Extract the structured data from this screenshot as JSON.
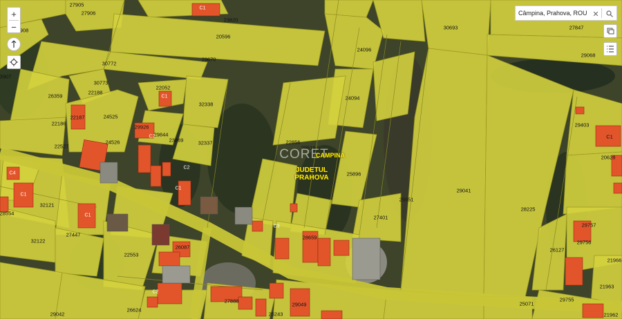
{
  "search": {
    "value": "Câmpina, Prahova, ROU"
  },
  "controls": {
    "zoom_in": "+",
    "zoom_out": "−"
  },
  "region_label": {
    "line1": "JUDETUL",
    "line2": "PRAHOVA"
  },
  "locality_label": "CAMPINA",
  "watermark": "CORET",
  "parcel_ids": [
    "27905",
    "27906",
    "908",
    "23820",
    "20596",
    "30693",
    "27847",
    "29068",
    "29670",
    "24096",
    "30772",
    "3907",
    "30773",
    "22188",
    "22052",
    "26359",
    "32338",
    "24094",
    "22187",
    "22186",
    "24525",
    "29926",
    "29844",
    "23869",
    "32337",
    "29403",
    "22527",
    "24526",
    "22856",
    "29519",
    "C1",
    "20628",
    "25896",
    "29041",
    "28554",
    "32121",
    "25551",
    "28225",
    "27447",
    "27401",
    "32122",
    "28659",
    "26087",
    "22553",
    "26127",
    "21966",
    "27888",
    "29049",
    "21963",
    "29042",
    "26624",
    "25243",
    "25071",
    "29755",
    "29757",
    "29756",
    "21962"
  ],
  "building_labels": [
    "C1",
    "C1",
    "C1",
    "C1",
    "C2",
    "C4",
    "C2",
    "C1",
    "C3",
    "C2"
  ],
  "colors": {
    "parcel_fill": "#d4d23e",
    "building_fill": "#e2552b",
    "road": "#c8c637",
    "vegetation_dark": "#3a4a26",
    "label_yellow": "#ffef00"
  },
  "icons": [
    "zoom-in-icon",
    "zoom-out-icon",
    "north-arrow-icon",
    "locate-icon",
    "search-icon",
    "clear-icon",
    "layers-icon",
    "list-icon"
  ]
}
